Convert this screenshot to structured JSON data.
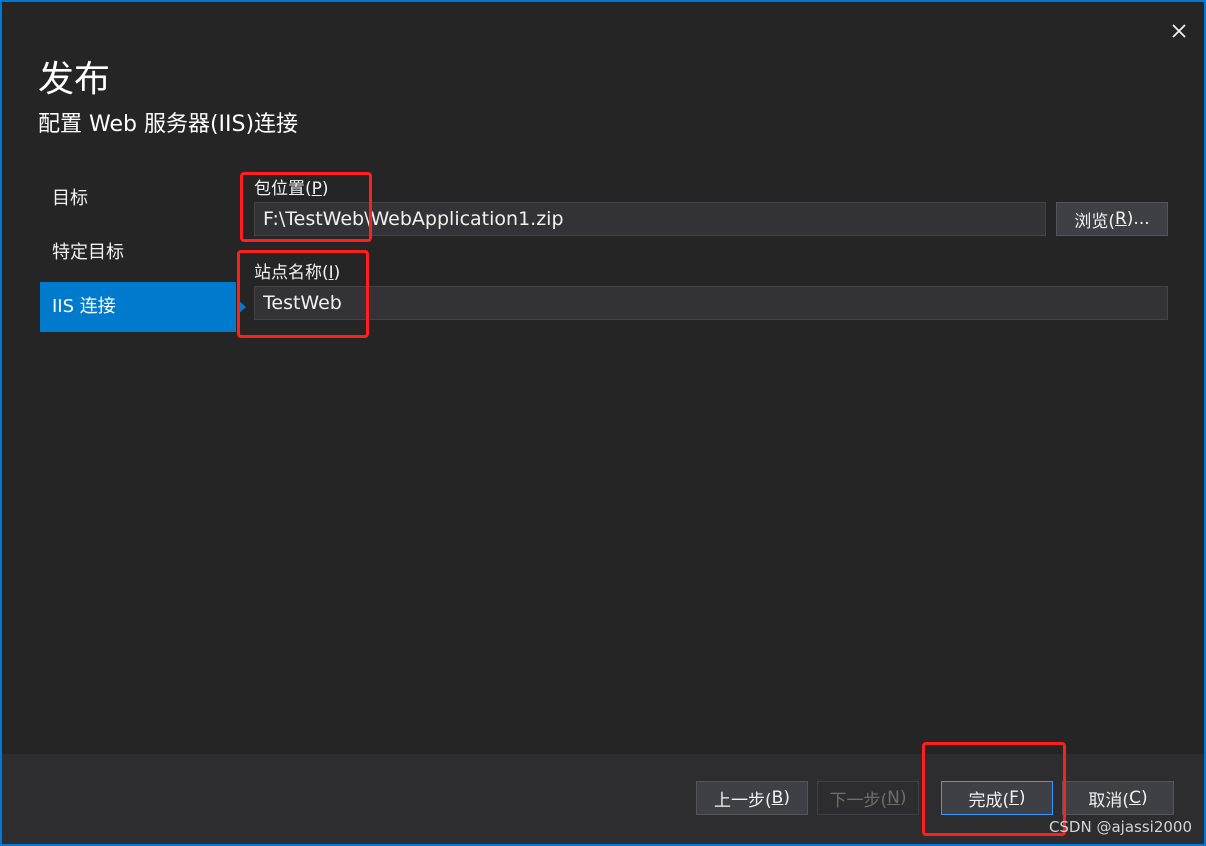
{
  "dialog": {
    "title": "发布",
    "subtitle": "配置 Web 服务器(IIS)连接",
    "close_icon": "close-icon"
  },
  "nav": {
    "items": [
      {
        "label": "目标",
        "active": false
      },
      {
        "label": "特定目标",
        "active": false
      },
      {
        "label": "IIS 连接",
        "active": true
      }
    ]
  },
  "form": {
    "package_location": {
      "label": "包位置(",
      "mnemonic": "P",
      "label_end": ")",
      "value": "F:\\TestWeb\\WebApplication1.zip"
    },
    "browse_button": {
      "label": "浏览(",
      "mnemonic": "R",
      "label_end": ")..."
    },
    "site_name": {
      "label": "站点名称(",
      "mnemonic": "I",
      "label_end": ")",
      "value": "TestWeb"
    }
  },
  "footer": {
    "prev": {
      "label": "上一步(",
      "mnemonic": "B",
      "label_end": ")"
    },
    "next": {
      "label": "下一步(",
      "mnemonic": "N",
      "label_end": ")"
    },
    "finish": {
      "label": "完成(",
      "mnemonic": "F",
      "label_end": ")"
    },
    "cancel": {
      "label": "取消(",
      "mnemonic": "C",
      "label_end": ")"
    }
  },
  "watermark": "CSDN @ajassi2000",
  "colors": {
    "accent": "#007acc",
    "annotation": "#ff1f1f",
    "background": "#252526"
  }
}
